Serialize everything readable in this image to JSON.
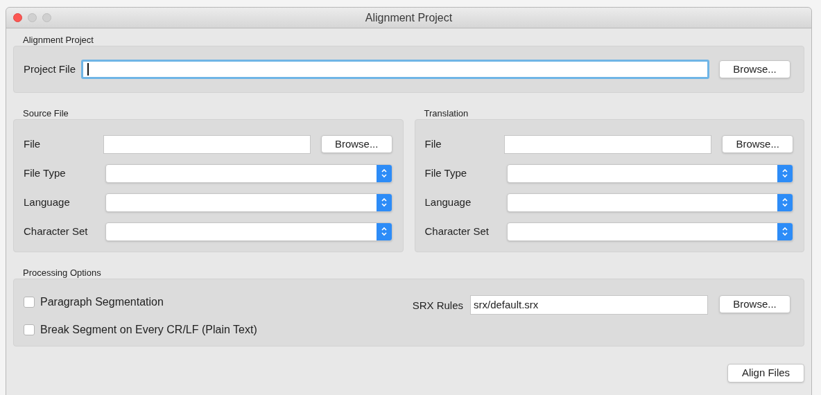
{
  "window": {
    "title": "Alignment Project"
  },
  "project": {
    "heading": "Alignment Project",
    "label": "Project File",
    "focused": true,
    "button": "Browse..."
  },
  "panels": [
    {
      "heading": "Source File",
      "file_label": "File",
      "button": "Browse...",
      "selects": [
        "File Type",
        "Language",
        "Character Set"
      ]
    },
    {
      "heading": "Translation",
      "file_label": "File",
      "button": "Browse...",
      "selects": [
        "File Type",
        "Language",
        "Character Set"
      ]
    }
  ],
  "processing": {
    "heading": "Processing Options",
    "options": [
      {
        "label": "Paragraph Segmentation",
        "checked": false
      },
      {
        "label": "Break Segment on Every CR/LF (Plain Text)",
        "checked": false
      }
    ],
    "srx_label": "SRX Rules",
    "srx_value": "srx/default.srx",
    "button": "Browse..."
  },
  "action_button": "Align Files"
}
